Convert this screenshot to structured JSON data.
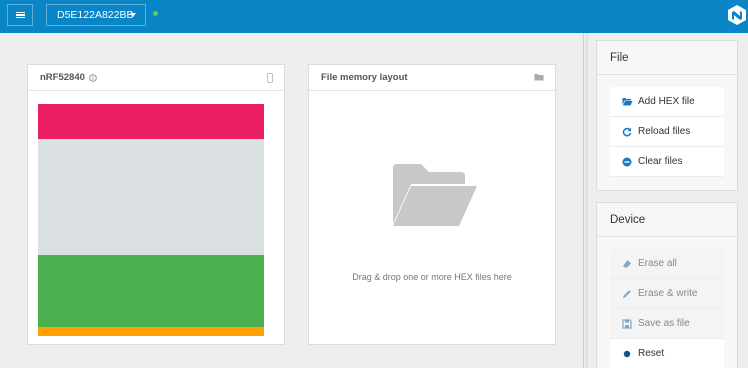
{
  "topbar": {
    "device_serial": "D5E122A822BB",
    "status_color": "#5fc95a",
    "bar_color": "#0a86c7"
  },
  "device_card": {
    "title": "nRF52840",
    "memory_regions": [
      {
        "color": "#ec1e63",
        "fraction": 0.15
      },
      {
        "color": "#dbe1e3",
        "fraction": 0.5
      },
      {
        "color": "#4cb050",
        "fraction": 0.31
      },
      {
        "color": "#fea000",
        "fraction": 0.04
      }
    ]
  },
  "layout_card": {
    "title": "File memory layout",
    "drop_hint": "Drag & drop one or more HEX files here"
  },
  "file_panel": {
    "title": "File",
    "buttons": [
      {
        "label": "Add HEX file",
        "icon": "folder-open-icon"
      },
      {
        "label": "Reload files",
        "icon": "refresh-icon"
      },
      {
        "label": "Clear files",
        "icon": "minus-circle-icon"
      }
    ]
  },
  "device_panel": {
    "title": "Device",
    "buttons": [
      {
        "label": "Erase all",
        "icon": "eraser-icon"
      },
      {
        "label": "Erase & write",
        "icon": "pencil-icon"
      },
      {
        "label": "Save as file",
        "icon": "floppy-icon"
      },
      {
        "label": "Reset",
        "icon": "circle-icon"
      }
    ]
  },
  "colors": {
    "accent": "#0a86c7"
  }
}
